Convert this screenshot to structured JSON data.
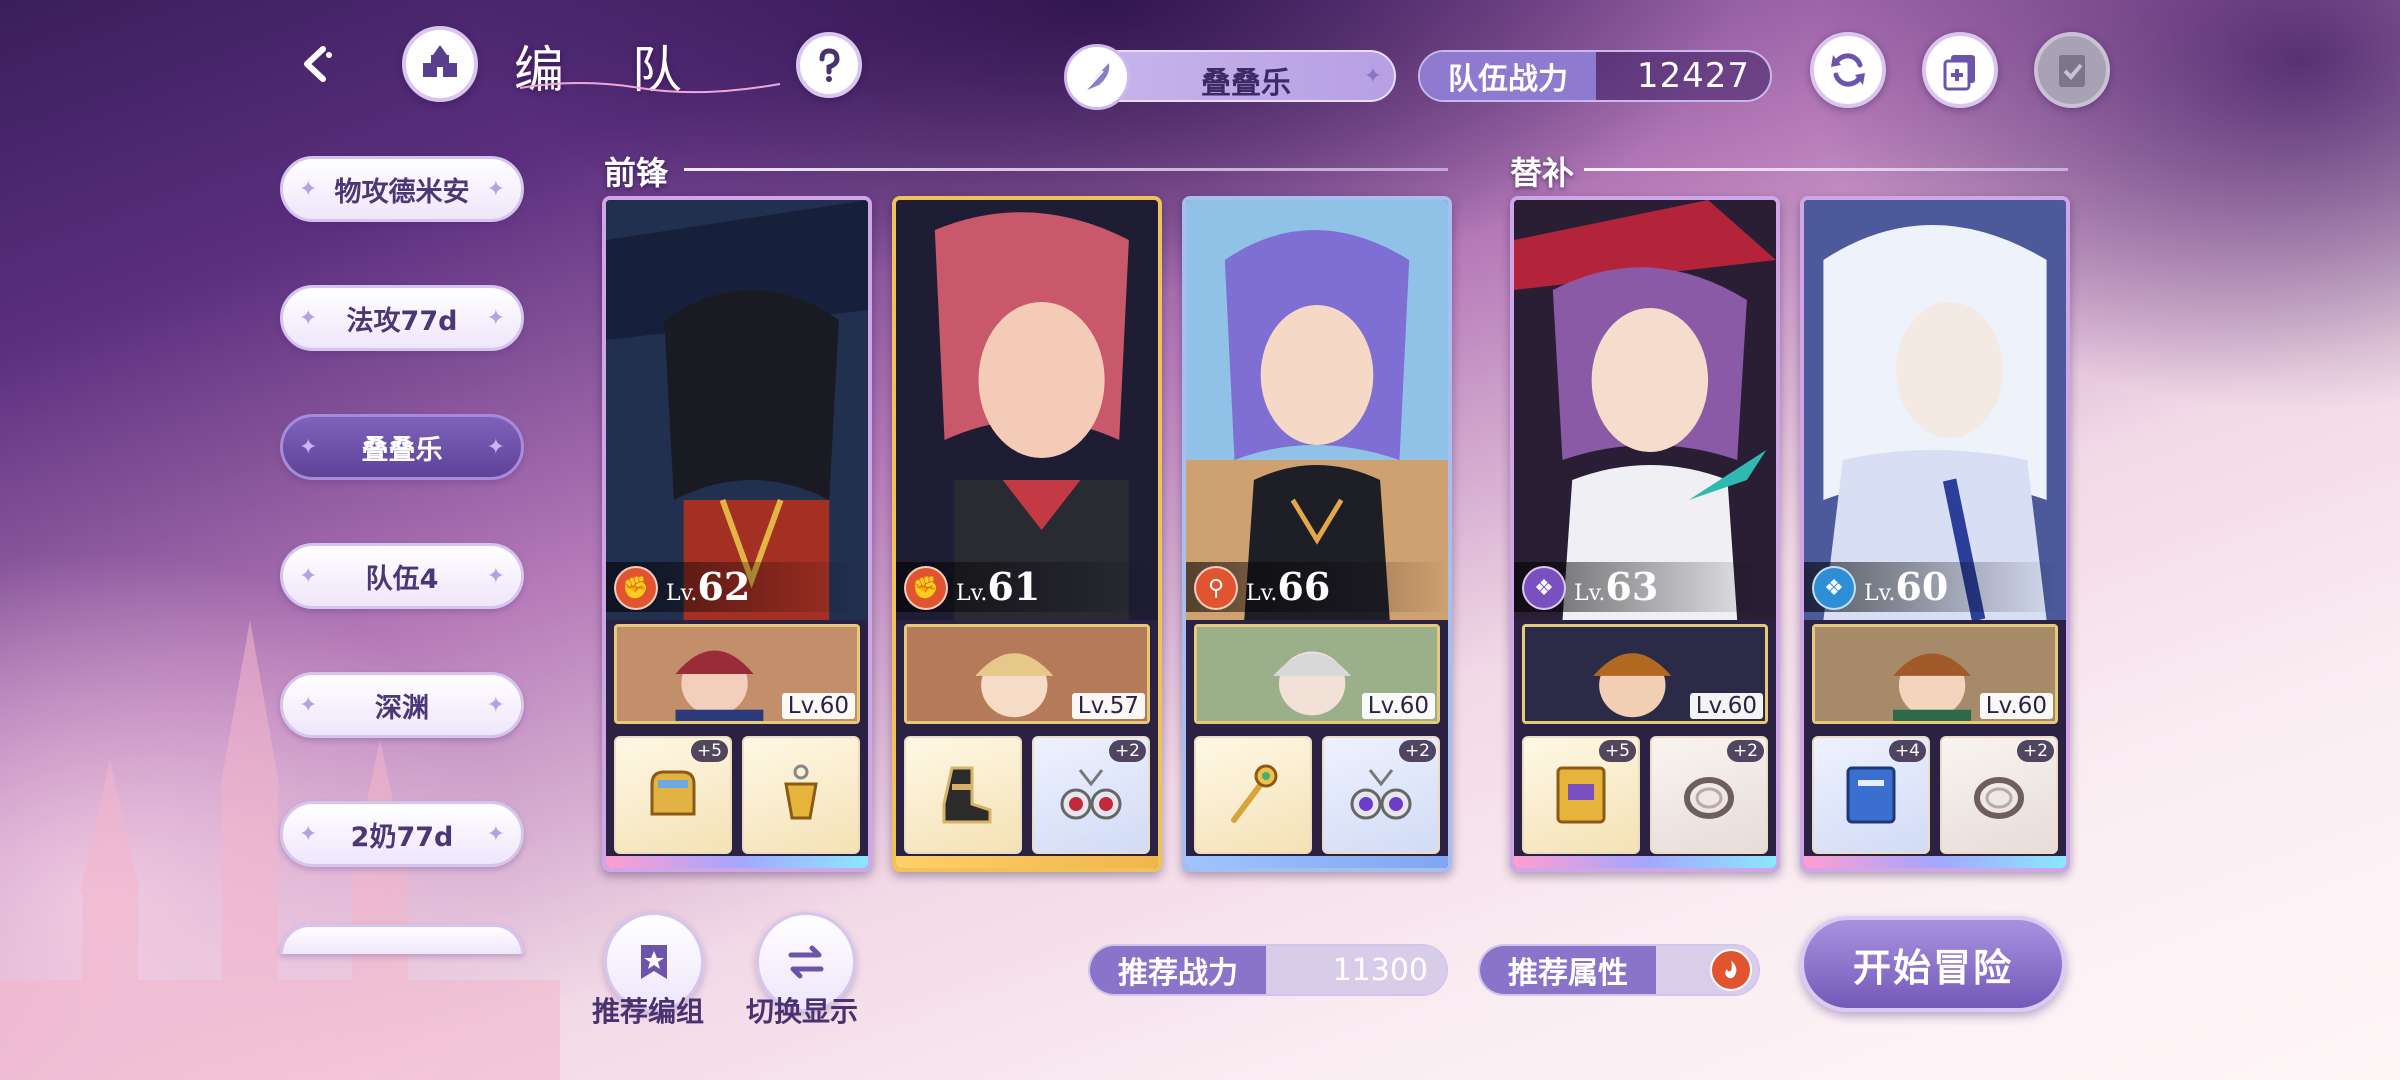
{
  "header": {
    "title": "编 队",
    "team_selector": "叠叠乐",
    "power_label": "队伍战力",
    "power_value": "12427"
  },
  "team_list": [
    {
      "label": "物攻德米安",
      "active": false
    },
    {
      "label": "法攻77d",
      "active": false
    },
    {
      "label": "叠叠乐",
      "active": true
    },
    {
      "label": "队伍4",
      "active": false
    },
    {
      "label": "深渊",
      "active": false
    },
    {
      "label": "2奶77d",
      "active": false
    }
  ],
  "sections": {
    "front": "前锋",
    "sub": "替补"
  },
  "cards": [
    {
      "element": "fire",
      "lv_prefix": "Lv.",
      "level": "62",
      "support_level": "Lv.60",
      "equip": [
        {
          "icon": "gauntlet-icon",
          "plus": "+5"
        },
        {
          "icon": "gold-earring-icon",
          "plus": ""
        }
      ]
    },
    {
      "element": "fire",
      "lv_prefix": "Lv.",
      "level": "61",
      "support_level": "Lv.57",
      "equip": [
        {
          "icon": "boot-icon",
          "plus": ""
        },
        {
          "icon": "red-earring-icon",
          "plus": "+2"
        }
      ]
    },
    {
      "element": "fire",
      "lv_prefix": "Lv.",
      "level": "66",
      "support_level": "Lv.60",
      "equip": [
        {
          "icon": "staff-icon",
          "plus": ""
        },
        {
          "icon": "purple-earring-icon",
          "plus": "+2"
        }
      ]
    },
    {
      "element": "dark",
      "lv_prefix": "Lv.",
      "level": "63",
      "support_level": "Lv.60",
      "equip": [
        {
          "icon": "gold-book-icon",
          "plus": "+5"
        },
        {
          "icon": "ring-icon",
          "plus": "+2"
        }
      ]
    },
    {
      "element": "water",
      "lv_prefix": "Lv.",
      "level": "60",
      "support_level": "Lv.60",
      "equip": [
        {
          "icon": "blue-book-icon",
          "plus": "+4"
        },
        {
          "icon": "ring-icon",
          "plus": "+2"
        }
      ]
    }
  ],
  "bottom": {
    "recommend_team_label": "推荐编组",
    "switch_display_label": "切换显示",
    "rec_power_label": "推荐战力",
    "rec_power_value": "11300",
    "rec_attr_label": "推荐属性",
    "start_label": "开始冒险"
  },
  "colors": {
    "accent": "#8a74ca",
    "fire": "#e0542f",
    "dark": "#7a4fc0",
    "water": "#2f8fd6"
  }
}
